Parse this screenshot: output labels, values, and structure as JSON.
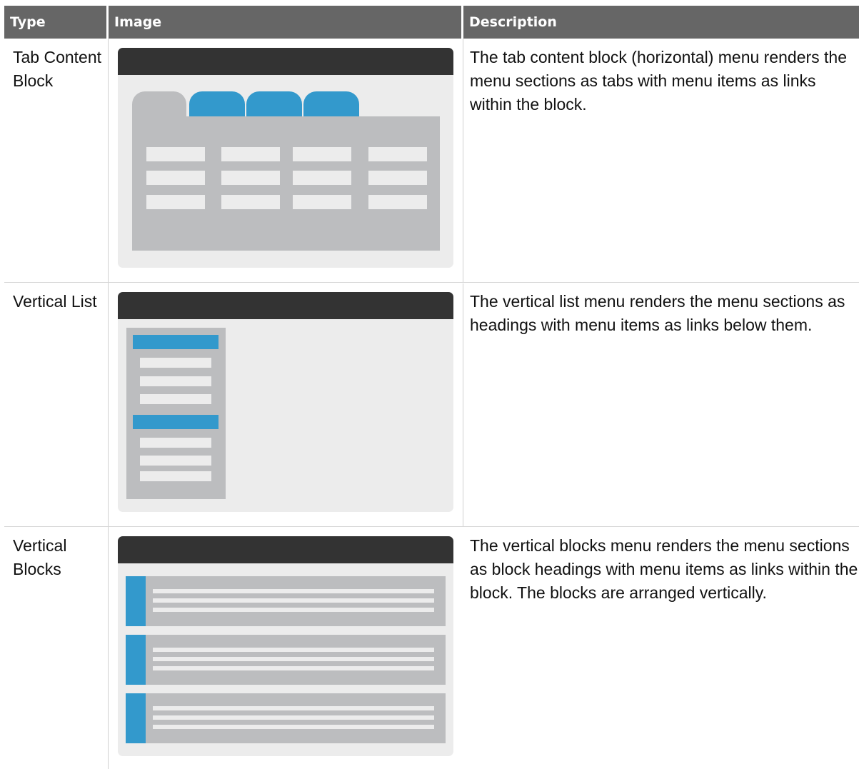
{
  "table": {
    "headers": {
      "type": "Type",
      "image": "Image",
      "description": "Description"
    },
    "rows": [
      {
        "type": "Tab Content Block",
        "image": "tab-content-block-diagram",
        "description": "The tab content block (horizontal) menu renders the menu sections as tabs with menu items as links within the block."
      },
      {
        "type": "Vertical List",
        "image": "vertical-list-diagram",
        "description": "The vertical list menu renders the menu sections as headings with menu items as links below them."
      },
      {
        "type": "Vertical Blocks",
        "image": "vertical-blocks-diagram",
        "description": "The vertical blocks menu renders the menu sections as block headings with menu items as links within the block. The blocks are arranged vertically."
      }
    ]
  },
  "colors": {
    "header_bg": "#666666",
    "header_text": "#ffffff",
    "diagram_bar": "#333333",
    "diagram_accent": "#3399cc",
    "diagram_panel": "#bcbdbf",
    "diagram_bg": "#ececec"
  }
}
